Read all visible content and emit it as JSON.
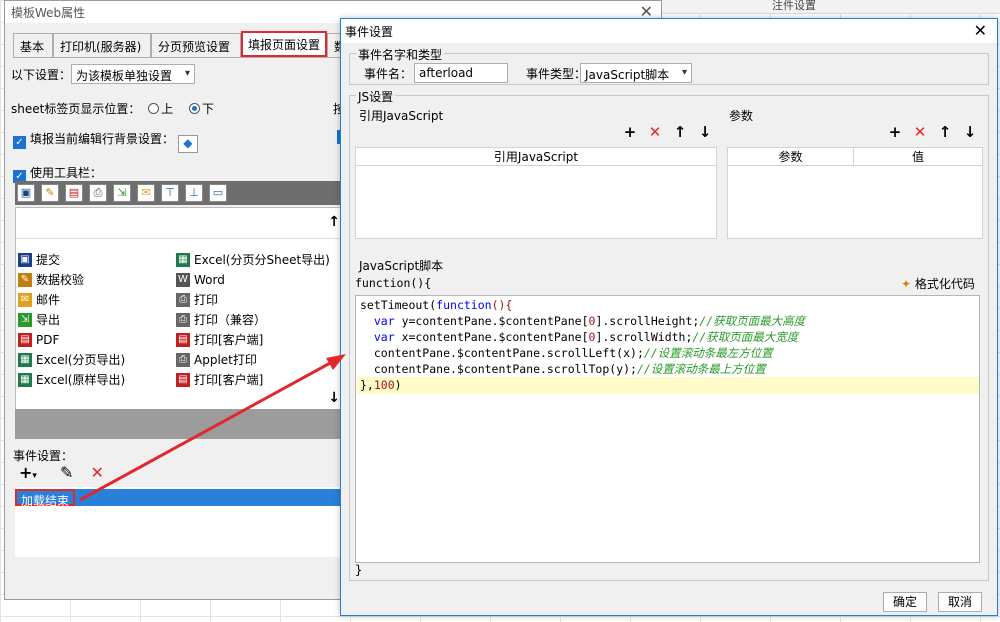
{
  "background": {
    "header_text": "注件设置"
  },
  "left_dialog": {
    "title": "模板Web属性",
    "tabs": [
      "基本",
      "打印机(服务器)",
      "分页预览设置",
      "填报页面设置",
      "数"
    ],
    "settings_label": "以下设置：",
    "settings_value": "为该模板单独设置",
    "sheet_pos_label": "sheet标签页显示位置：",
    "radio_top": "上",
    "radio_bottom": "下",
    "bg_label": "填报当前编辑行背景设置：",
    "use_toolbar_label": "使用工具栏：",
    "right_cut_1": "按",
    "buttons": {
      "col1": [
        "提交",
        "数据校验",
        "邮件",
        "导出",
        "PDF",
        "Excel(分页导出)",
        "Excel(原样导出)"
      ],
      "col2": [
        "Excel(分页分Sheet导出)",
        "Word",
        "打印",
        "打印（兼容）",
        "打印[客户端]",
        "Applet打印",
        "打印[客户端]"
      ]
    },
    "events_label": "事件设置：",
    "event_item": "加载结束"
  },
  "right_dialog": {
    "title": "事件设置",
    "name_type_group": "事件名字和类型",
    "event_name_label": "事件名：",
    "event_name_value": "afterload",
    "event_type_label": "事件类型：",
    "event_type_value": "JavaScript脚本",
    "js_group": "JS设置",
    "ref_js_label": "引用JavaScript",
    "params_label": "参数",
    "ref_js_col": "引用JavaScript",
    "param_col": "参数",
    "value_col": "值",
    "script_label": "JavaScript脚本",
    "func_open": "function(){",
    "format_label": "格式化代码",
    "func_close": "}",
    "ok": "确定",
    "cancel": "取消",
    "code": {
      "l1a": "setTimeout(",
      "l1b": "function",
      "l1c": "(){",
      "l2a": "  ",
      "l2b": "var",
      "l2c": " y=contentPane.$contentPane[",
      "l2d": "0",
      "l2e": "].scrollHeight;",
      "l2f": "//获取页面最大高度",
      "l3a": "  ",
      "l3b": "var",
      "l3c": " x=contentPane.$contentPane[",
      "l3d": "0",
      "l3e": "].scrollWidth;",
      "l3f": "//获取页面最大宽度",
      "l4a": "  contentPane.$contentPane.scrollLeft(x);",
      "l4b": "//设置滚动条最左方位置",
      "l5a": "  contentPane.$contentPane.scrollTop(y);",
      "l5b": "//设置滚动条最上方位置",
      "l6a": "},",
      "l6b": "100",
      "l6c": ")"
    }
  },
  "colors": {
    "accent": "#1e7fe0",
    "highlight_red": "#e0282e",
    "selection_blue": "#2a7fd8"
  }
}
